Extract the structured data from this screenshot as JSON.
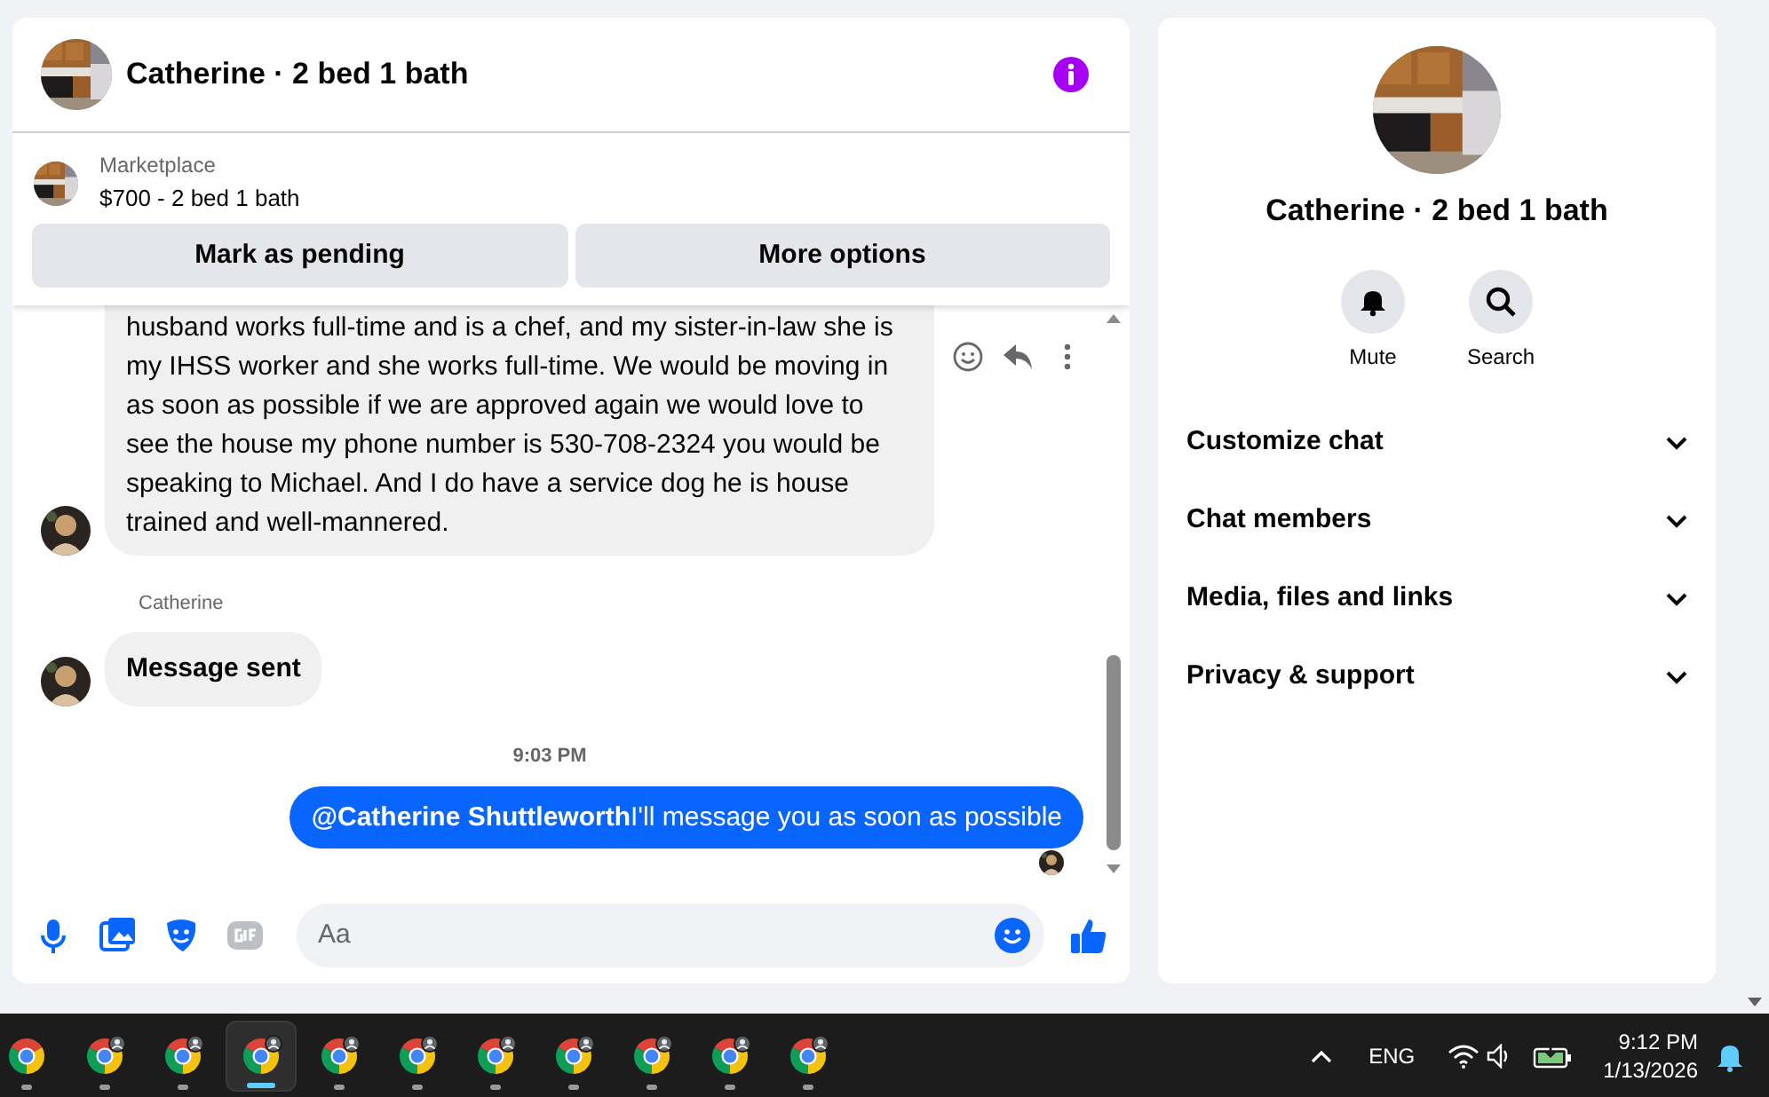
{
  "header": {
    "title": "Catherine · 2 bed 1 bath"
  },
  "listing": {
    "source": "Marketplace",
    "title": "$700 - 2 bed 1 bath",
    "buttons": [
      "Mark as pending",
      "More options"
    ]
  },
  "messages": [
    {
      "kind": "received",
      "text": "husband works full-time and is a chef, and my sister-in-law she is my IHSS worker and she works full-time. We would be moving in as soon as possible if we are approved again we would love to see the house my phone number is 530-708-2324 you would be speaking to Michael. And I do have a service dog he is house trained and well-mannered.",
      "bold": false,
      "hovered": true,
      "clipped": true
    },
    {
      "kind": "sender",
      "text": "Catherine"
    },
    {
      "kind": "received",
      "text": "Message sent",
      "bold": true,
      "hovered": false,
      "clipped": false
    },
    {
      "kind": "time",
      "text": "9:03 PM"
    },
    {
      "kind": "sent",
      "text": "**@Catherine Shuttleworth**I'll message you as soon as possible",
      "seen": true
    }
  ],
  "composer": {
    "placeholder": "Aa"
  },
  "details": {
    "title": "Catherine · 2 bed 1 bath",
    "actions": [
      {
        "kind": "mute",
        "label": "Mute"
      },
      {
        "kind": "search",
        "label": "Search"
      }
    ],
    "sections": [
      {
        "label": "Customize chat",
        "expanded": false
      },
      {
        "label": "Chat members",
        "expanded": false
      },
      {
        "label": "Media, files and links",
        "expanded": false
      },
      {
        "label": "Privacy & support",
        "expanded": false
      }
    ]
  },
  "taskbar": {
    "apps": [
      {
        "kind": "chrome",
        "selected": false
      },
      {
        "kind": "chrome_profile",
        "selected": false
      },
      {
        "kind": "chrome_profile",
        "selected": false
      },
      {
        "kind": "chrome_profile",
        "selected": true
      },
      {
        "kind": "chrome_profile",
        "selected": false
      },
      {
        "kind": "chrome_profile",
        "selected": false
      },
      {
        "kind": "chrome_profile",
        "selected": false
      },
      {
        "kind": "chrome_profile",
        "selected": false
      },
      {
        "kind": "chrome_profile",
        "selected": false
      },
      {
        "kind": "chrome_profile",
        "selected": false
      },
      {
        "kind": "chrome_profile",
        "selected": false
      }
    ],
    "tray": {
      "language": "ENG",
      "time": "9:12 PM",
      "date": "1/13/2026"
    }
  }
}
